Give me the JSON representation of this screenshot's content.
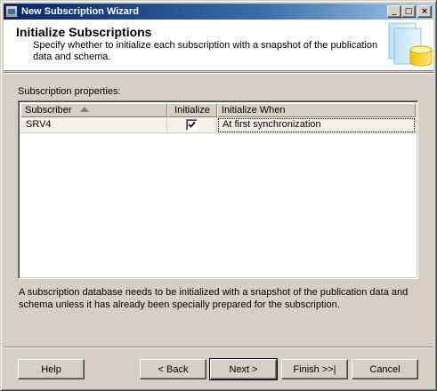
{
  "window": {
    "title": "New Subscription Wizard",
    "controls": {
      "minimize": "_",
      "maximize": "□",
      "close": "×"
    }
  },
  "header": {
    "title": "Initialize Subscriptions",
    "description": "Specify whether to initialize each subscription with a snapshot of the publication data and schema."
  },
  "properties": {
    "label": "Subscription properties:",
    "columns": [
      "Subscriber",
      "Initialize",
      "Initialize When"
    ],
    "rows": [
      {
        "subscriber": "SRV4",
        "initialize": true,
        "initialize_when": "At first synchronization"
      }
    ]
  },
  "note": "A subscription database needs to be initialized with a snapshot of the publication data and schema unless it has already been specially prepared for the subscription.",
  "buttons": {
    "help": "Help",
    "back": "< Back",
    "next": "Next >",
    "finish": "Finish >>|",
    "cancel": "Cancel"
  },
  "colors": {
    "titlebar_start": "#0a246a",
    "titlebar_end": "#a6caf0",
    "face": "#d4d0c8"
  }
}
